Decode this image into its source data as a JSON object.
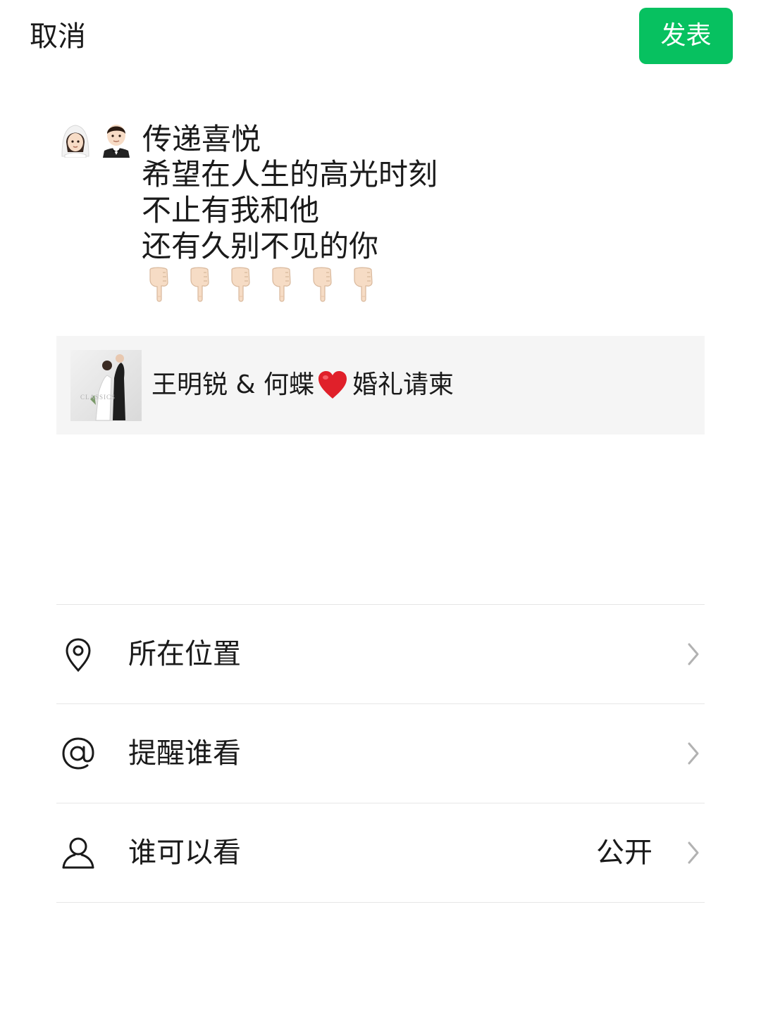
{
  "header": {
    "cancel_label": "取消",
    "publish_label": "发表"
  },
  "colors": {
    "accent": "#07c160",
    "card_background": "#f5f5f5",
    "divider": "#e6e6e6",
    "icon": "#1a1a1a",
    "chevron": "#b2b2b2"
  },
  "post": {
    "leading_emojis": [
      "bride-emoji",
      "groom-emoji"
    ],
    "first_line": "传递喜悦",
    "lines": [
      "希望在人生的高光时刻",
      "不止有我和他",
      "还有久别不见的你"
    ],
    "pointer_emoji": "backhand-index-pointing-down-emoji",
    "pointer_count": 6
  },
  "link_card": {
    "thumbnail": "wedding-photo-thumbnail",
    "title_before_heart": "王明锐 & 何蝶",
    "heart_emoji": "red-heart-emoji",
    "title_after_heart": "婚礼请柬"
  },
  "options": [
    {
      "icon": "location-pin-icon",
      "label": "所在位置",
      "value": ""
    },
    {
      "icon": "at-sign-icon",
      "label": "提醒谁看",
      "value": ""
    },
    {
      "icon": "person-icon",
      "label": "谁可以看",
      "value": "公开"
    }
  ]
}
